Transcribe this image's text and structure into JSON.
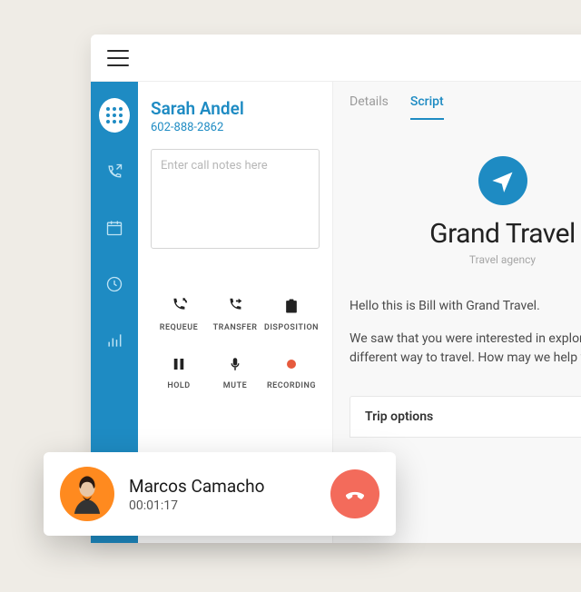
{
  "caller": {
    "name": "Sarah Andel",
    "phone": "602-888-2862",
    "notes_placeholder": "Enter call notes here"
  },
  "actions": {
    "requeue": "REQUEUE",
    "transfer": "TRANSFER",
    "disposition": "DISPOSITION",
    "hold": "HOLD",
    "mute": "MUTE",
    "recording": "RECORDING"
  },
  "tabs": {
    "details": "Details",
    "script": "Script"
  },
  "brand": {
    "name": "Grand Travel",
    "subtitle": "Travel agency"
  },
  "script": {
    "line1": "Hello this is Bill with Grand Travel.",
    "line2": "We saw that you were interested in exploring a",
    "line3": "different way to travel. How may we help you today?"
  },
  "trip_options_label": "Trip options",
  "floating_call": {
    "name": "Marcos Camacho",
    "duration": "00:01:17"
  }
}
